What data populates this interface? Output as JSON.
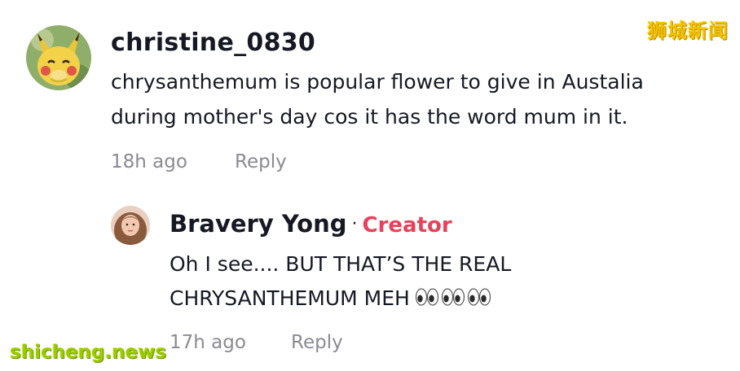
{
  "watermarks": {
    "top_right": "狮城新闻",
    "bottom_left": "shicheng.news",
    "top_color": "#f2c200",
    "bottom_color": "#9ccc00"
  },
  "comment": {
    "username": "christine_0830",
    "text_line1": "chrysanthemum is popular flower to give in Austalia",
    "text_line2": "during mother's day cos it has the word mum in it.",
    "time": "18h ago",
    "reply_label": "Reply",
    "avatar_icon": "pikachu-avatar"
  },
  "reply": {
    "username": "Bravery Yong",
    "separator": "·",
    "badge": "Creator",
    "badge_color": "#e6435b",
    "text_line1": "Oh I see.... BUT THAT’S THE REAL",
    "text_line2": "CHRYSANTHEMUM MEH",
    "emoji_icon": "eyes-emoji-icon",
    "emoji_count": 3,
    "time": "17h ago",
    "reply_label": "Reply",
    "avatar_icon": "user-photo-avatar"
  }
}
